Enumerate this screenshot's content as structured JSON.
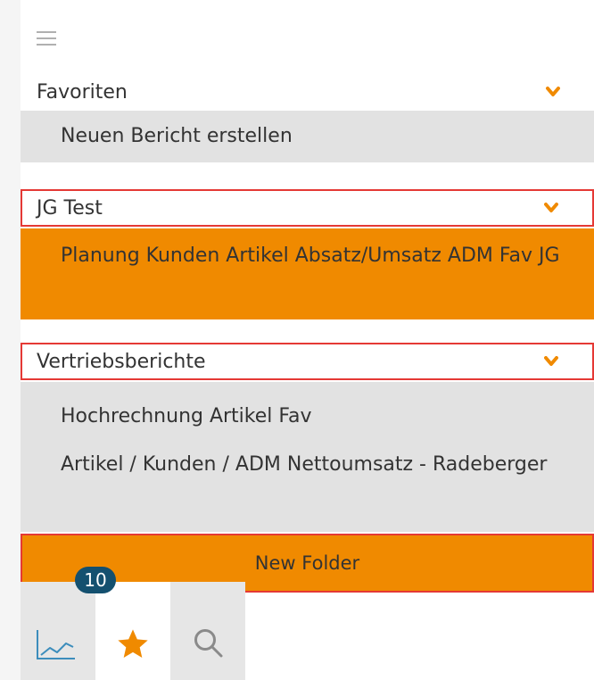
{
  "sections": [
    {
      "title": "Favoriten",
      "items": [
        "Neuen Bericht erstellen"
      ]
    },
    {
      "title": "JG Test",
      "items": [
        "Planung Kunden Artikel Absatz/Umsatz ADM Fav JG"
      ]
    },
    {
      "title": "Vertriebsberichte",
      "items": [
        "Hochrechnung Artikel  Fav",
        "Artikel / Kunden / ADM Nettoumsatz - Radeberger"
      ]
    }
  ],
  "new_folder_label": "New Folder",
  "badge_count": "10",
  "colors": {
    "accent": "#f08a00",
    "highlight_border": "#e53935",
    "badge": "#14506f",
    "item_bg": "#e2e2e2"
  },
  "bottom_tabs": [
    {
      "icon": "chart-line-icon"
    },
    {
      "icon": "star-icon",
      "active": true
    },
    {
      "icon": "search-icon"
    }
  ]
}
